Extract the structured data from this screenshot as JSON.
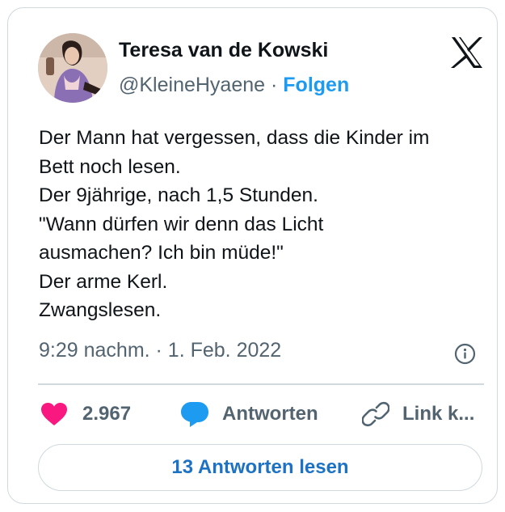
{
  "author": {
    "name": "Teresa van de Kowski",
    "handle": "@KleineHyaene",
    "separator": "·",
    "follow_label": "Folgen"
  },
  "tweet": {
    "lines": [
      "Der Mann hat vergessen, dass die Kinder im",
      "Bett noch lesen.",
      "Der 9jährige, nach 1,5 Stunden.",
      "\"Wann dürfen wir denn das Licht",
      "ausmachen? Ich bin müde!\"",
      "Der arme Kerl.",
      "Zwangslesen."
    ],
    "timestamp": "9:29 nachm. · 1. Feb. 2022"
  },
  "actions": {
    "like_count": "2.967",
    "reply_label": "Antworten",
    "link_label": "Link k..."
  },
  "read_replies_label": "13 Antworten lesen",
  "icons": {
    "logo": "x-logo-icon",
    "info": "info-icon",
    "like": "heart-icon",
    "reply": "speech-bubble-icon",
    "link": "link-icon"
  },
  "colors": {
    "accent": "#1d9bf0",
    "like": "#f91880",
    "muted": "#536471",
    "text": "#0f1419",
    "border": "#cfd9de"
  }
}
